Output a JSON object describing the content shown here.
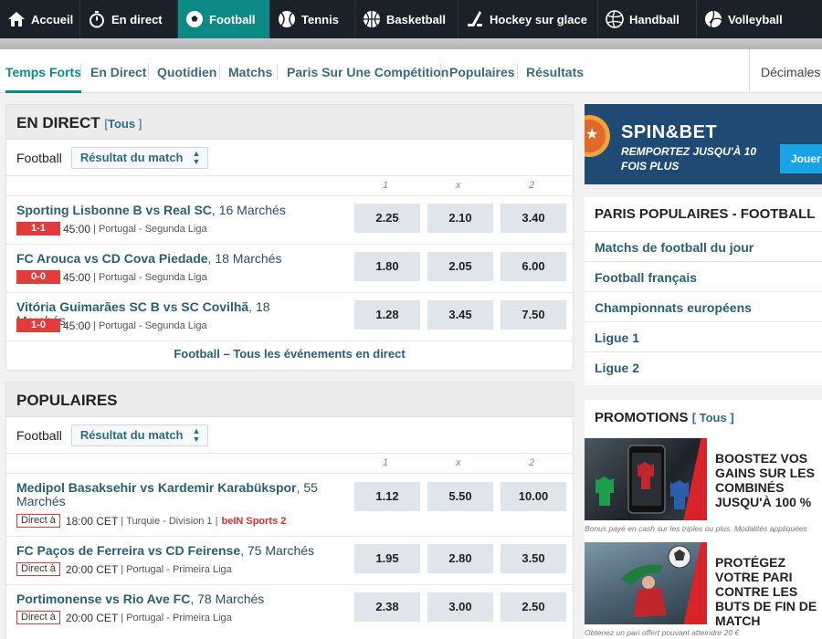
{
  "nav": {
    "sports": [
      {
        "label": "Accueil",
        "icon": "home-icon",
        "active": false
      },
      {
        "label": "En direct",
        "icon": "stopwatch-icon",
        "active": false
      },
      {
        "label": "Football",
        "icon": "soccer-ball-icon",
        "active": true
      },
      {
        "label": "Tennis",
        "icon": "tennis-ball-icon",
        "active": false
      },
      {
        "label": "Basketball",
        "icon": "basketball-icon",
        "active": false
      },
      {
        "label": "Hockey sur glace",
        "icon": "hockey-stick-icon",
        "active": false
      },
      {
        "label": "Handball",
        "icon": "handball-icon",
        "active": false
      },
      {
        "label": "Volleyball",
        "icon": "volleyball-icon",
        "active": false
      }
    ]
  },
  "subtabs": {
    "items": [
      "Temps Forts",
      "En Direct",
      "Quotidien",
      "Matchs",
      "Paris Sur Une Compétition",
      "Populaires",
      "Résultats"
    ],
    "active": "Temps Forts",
    "odds_format": "Décimales"
  },
  "live": {
    "heading": "EN DIRECT",
    "tous": "Tous",
    "sport_label": "Football",
    "market_select": "Résultat du match",
    "columns": [
      "1",
      "x",
      "2"
    ],
    "matches": [
      {
        "teams": "Sporting Lisbonne B vs Real SC",
        "markets": "16 Marchés",
        "score": "1-1",
        "time": "45:00",
        "league": "Portugal - Segunda Liga",
        "odds": [
          "2.25",
          "2.10",
          "3.40"
        ]
      },
      {
        "teams": "FC Arouca vs CD Cova Piedade",
        "markets": "18 Marchés",
        "score": "0-0",
        "time": "45:00",
        "league": "Portugal - Segunda Liga",
        "odds": [
          "1.80",
          "2.05",
          "6.00"
        ]
      },
      {
        "teams": "Vitória Guimarães SC B vs SC Covilhã",
        "markets": "18 Marchés",
        "score": "1-0",
        "time": "45:00",
        "league": "Portugal - Segunda Liga",
        "odds": [
          "1.28",
          "3.45",
          "7.50"
        ]
      }
    ],
    "all_link": "Football – Tous les événements en direct"
  },
  "popular": {
    "heading": "POPULAIRES",
    "sport_label": "Football",
    "market_select": "Résultat du match",
    "columns": [
      "1",
      "x",
      "2"
    ],
    "matches": [
      {
        "teams": "Medipol Basaksehir vs Kardemir Karabükspor",
        "markets": "55 Marchés",
        "badge": "Direct à",
        "time": "18:00 CET",
        "league": "Turquie - Division 1",
        "channel": "beIN Sports 2",
        "odds": [
          "1.12",
          "5.50",
          "10.00"
        ]
      },
      {
        "teams": "FC Paços de Ferreira vs CD Feirense",
        "markets": "75 Marchés",
        "badge": "Direct à",
        "time": "20:00 CET",
        "league": "Portugal - Primeira Liga",
        "channel": "",
        "odds": [
          "1.95",
          "2.80",
          "3.50"
        ]
      },
      {
        "teams": "Portimonense vs Rio Ave FC",
        "markets": "78 Marchés",
        "badge": "Direct à",
        "time": "20:00 CET",
        "league": "Portugal - Primeira Liga",
        "channel": "",
        "odds": [
          "2.38",
          "3.00",
          "2.50"
        ]
      }
    ]
  },
  "spin": {
    "title": "SPIN&BET",
    "subtitle": "REMPORTEZ JUSQU'À 10 FOIS PLUS",
    "button": "Jouer"
  },
  "paris_populaires": {
    "heading": "PARIS POPULAIRES - FOOTBALL",
    "links": [
      "Matchs de football du jour",
      "Football français",
      "Championnats européens",
      "Ligue 1",
      "Ligue 2"
    ]
  },
  "promotions": {
    "heading": "PROMOTIONS",
    "tous": "Tous",
    "items": [
      {
        "text": "BOOSTEZ VOS GAINS SUR LES COMBINÉS JUSQU'À 100 %",
        "caption": "Bonus payé en cash sur les triples ou plus. Modalités appliquées"
      },
      {
        "text": "PROTÉGEZ VOTRE PARI CONTRE LES BUTS DE FIN DE MATCH",
        "caption": "Obtenez un pari offert pouvant atteindre 20 €"
      }
    ]
  },
  "colors": {
    "nav_bg": "#1b2129",
    "accent": "#0e8a86",
    "link": "#2a5f73",
    "live_red": "#e23b3b"
  }
}
